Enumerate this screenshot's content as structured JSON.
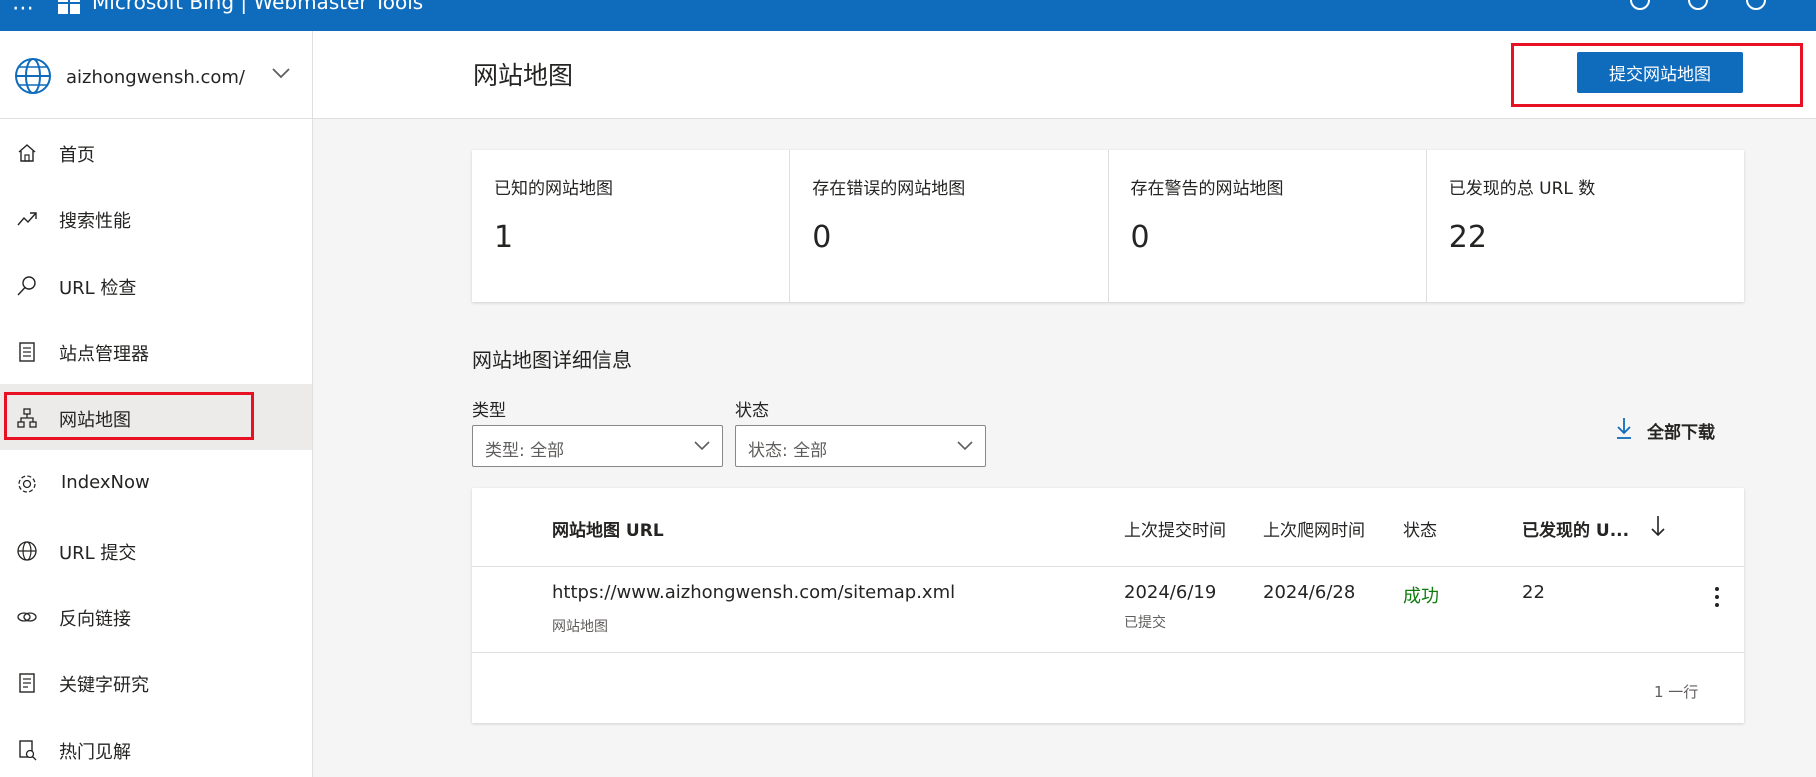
{
  "topbar": {
    "brand": "Microsoft Bing  |  Webmaster Tools",
    "waffle": "⋯"
  },
  "sidebar": {
    "site": "aizhongwensh.com/",
    "items": [
      {
        "label": "首页",
        "icon": "home-icon"
      },
      {
        "label": "搜索性能",
        "icon": "trend-icon"
      },
      {
        "label": "URL 检查",
        "icon": "search-icon"
      },
      {
        "label": "站点管理器",
        "icon": "document-list-icon"
      },
      {
        "label": "网站地图",
        "icon": "sitemap-icon",
        "active": true
      },
      {
        "label": "IndexNow",
        "icon": "gear-icon"
      },
      {
        "label": "URL 提交",
        "icon": "globe-icon"
      },
      {
        "label": "反向链接",
        "icon": "link-icon"
      },
      {
        "label": "关键字研究",
        "icon": "notepad-icon"
      },
      {
        "label": "热门见解",
        "icon": "insights-icon"
      }
    ]
  },
  "header": {
    "title": "网站地图",
    "submit_button": "提交网站地图"
  },
  "stats": [
    {
      "label": "已知的网站地图",
      "value": "1"
    },
    {
      "label": "存在错误的网站地图",
      "value": "0"
    },
    {
      "label": "存在警告的网站地图",
      "value": "0"
    },
    {
      "label": "已发现的总 URL 数",
      "value": "22"
    }
  ],
  "details": {
    "title": "网站地图详细信息",
    "type_label": "类型",
    "type_value": "类型: 全部",
    "status_label": "状态",
    "status_value": "状态: 全部",
    "download_label": "全部下载"
  },
  "table": {
    "columns": {
      "url": "网站地图 URL",
      "last_submitted": "上次提交时间",
      "last_crawled": "上次爬网时间",
      "status": "状态",
      "discovered": "已发现的 U..."
    },
    "rows": [
      {
        "url": "https://www.aizhongwensh.com/sitemap.xml",
        "url_sub": "网站地图",
        "last_submitted": "2024/6/19",
        "last_submitted_sub": "已提交",
        "last_crawled": "2024/6/28",
        "status": "成功",
        "discovered": "22"
      }
    ],
    "row_count": "1 一行"
  },
  "colors": {
    "accent": "#0f6cbd",
    "success": "#107c10",
    "highlight": "#e81123"
  }
}
